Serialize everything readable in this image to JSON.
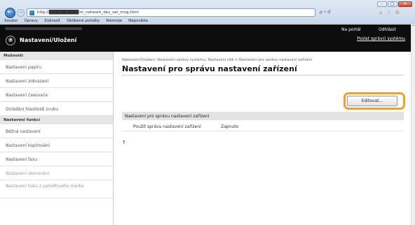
{
  "browser": {
    "url": "http://██████████/m_network_dev_set_mng.html",
    "address_tools": "ρ • ď",
    "window_buttons": {
      "minimize": "–",
      "maximize": "□",
      "close": "✕"
    },
    "menu": [
      "Soubor",
      "Úpravy",
      "Zobrazit",
      "Oblíbené položky",
      "Nástroje",
      "Nápověda"
    ],
    "toolbar_icons": [
      "home-icon",
      "star-icon",
      "gear-icon"
    ]
  },
  "header": {
    "app_title": "Nastavení/Uložení",
    "portal_link": "Na portál",
    "logout_link": "Odhlásit",
    "manager_link": "Poslat správci systému"
  },
  "sidebar": {
    "sections": [
      {
        "title": "Možnosti",
        "items": [
          {
            "label": "Nastavení papíru",
            "dim": false
          },
          {
            "label": "Nastavení zobrazení",
            "dim": false
          },
          {
            "label": "Nastavení časovače",
            "dim": false
          },
          {
            "label": "Ovládání hlasitosti zvuku",
            "dim": false
          }
        ]
      },
      {
        "title": "Nastavení funkcí",
        "items": [
          {
            "label": "Běžná nastavení",
            "dim": false
          },
          {
            "label": "Nastavení kopírování",
            "dim": false
          },
          {
            "label": "Nastavení faxu",
            "dim": false
          },
          {
            "label": "Nastavení skenování",
            "dim": true
          },
          {
            "label": "Nastavení tisku z paměťového média",
            "dim": true
          }
        ]
      }
    ]
  },
  "main": {
    "breadcrumb": "Nastavení/Uložení: Nastavení správy systému: Nastavení sítě > Nastavení pro správu nastavení zařízení",
    "title": "Nastavení pro správu nastavení zařízení",
    "edit_button": "Editovat...",
    "section_header": "Nastavení pro správu nastavení zařízení",
    "row_label": "Použít správu nastavení zařízení",
    "row_value": "Zapnuto",
    "scroll_top_icon": "↑"
  },
  "colors": {
    "header_bg": "#0d0d0d",
    "highlight": "#f0a030",
    "section_bg": "#e3e3e3"
  }
}
